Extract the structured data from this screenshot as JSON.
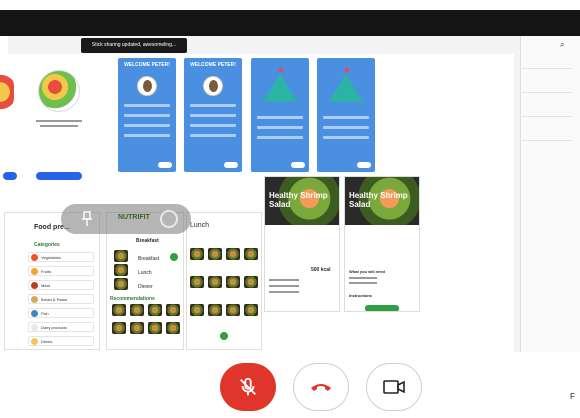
{
  "meeting": {
    "toast": "Stick sharing updated, awesomeling...",
    "corner_letter": "F"
  },
  "design": {
    "welcome_title": "WELCOME PETER!",
    "food_panel_title": "Food pre...",
    "categories_label": "Categories",
    "categories": [
      "Vegetables",
      "Fruits",
      "Meat",
      "Bread & Pasta",
      "Fish",
      "Dairy products",
      "Drinks"
    ],
    "category_colors": [
      "#e8552a",
      "#f2a43a",
      "#c0392b",
      "#d8a85a",
      "#3a88c8",
      "#e8e8e8",
      "#f2c84b"
    ],
    "brand": "NUTRIFIT",
    "lunch_label": "Lunch",
    "meals": [
      "Breakfast",
      "Lunch",
      "Dinner"
    ],
    "recommendations_label": "Recommendations",
    "card_title": "Healthy Shrimp Salad",
    "calories": "500 kcal",
    "cook_button": "Cook Now",
    "what_you_need": "What you will need",
    "instructions": "Instructions"
  },
  "controls": {
    "mic_icon": "mic-off-icon",
    "end_icon": "phone-hangup-icon",
    "cam_icon": "camera-icon"
  },
  "colors": {
    "mic_red": "#e0352b",
    "design_blue": "#4b8fe0",
    "brand_green": "#2f9e44"
  }
}
